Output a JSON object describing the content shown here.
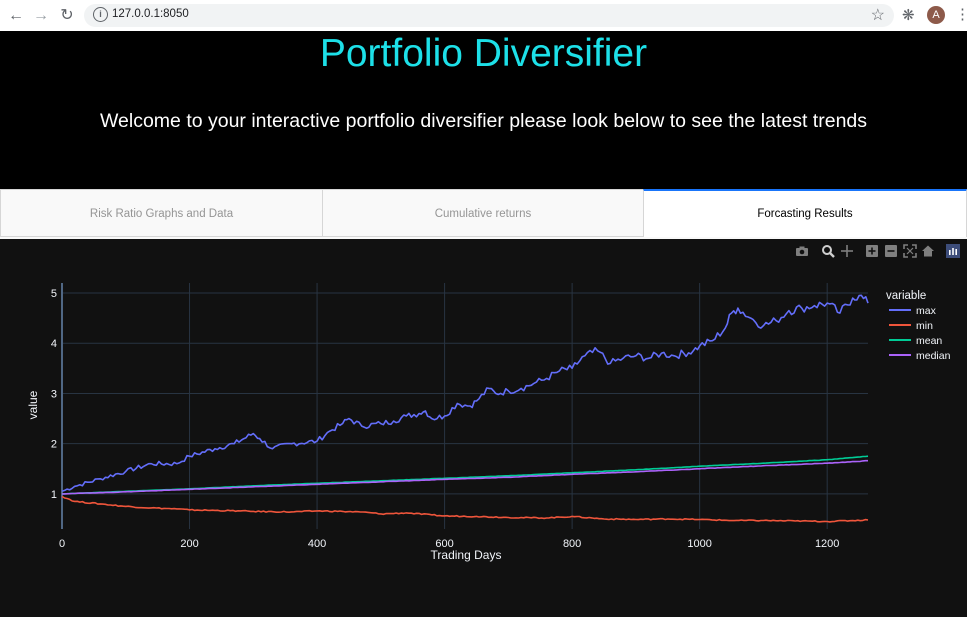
{
  "browser": {
    "url": "127.0.0.1:8050",
    "avatar_letter": "A"
  },
  "header": {
    "title": "Portfolio Diversifier",
    "subtitle": "Welcome to your interactive portfolio diversifier please look below to see the latest trends",
    "title_color": "#1de0e8"
  },
  "tabs": [
    {
      "label": "Risk Ratio Graphs and Data",
      "active": false
    },
    {
      "label": "Cumulative returns",
      "active": false
    },
    {
      "label": "Forcasting Results",
      "active": true
    }
  ],
  "modebar": [
    "camera-icon",
    "zoom-icon",
    "pan-icon",
    "zoom-in-icon",
    "zoom-out-icon",
    "autoscale-icon",
    "reset-axes-icon",
    "plotly-logo-icon"
  ],
  "chart_data": {
    "type": "line",
    "xlabel": "Trading Days",
    "ylabel": "value",
    "xlim": [
      0,
      1264
    ],
    "ylim": [
      0.3,
      5.2
    ],
    "xticks": [
      "0",
      "200",
      "400",
      "600",
      "800",
      "1000",
      "1200"
    ],
    "yticks": [
      "1",
      "2",
      "3",
      "4",
      "5"
    ],
    "legend_title": "variable",
    "legend_position": "right",
    "grid": true,
    "series": [
      {
        "name": "max",
        "color": "#636efa",
        "x": [
          0,
          20,
          60,
          100,
          140,
          180,
          200,
          240,
          270,
          300,
          310,
          330,
          360,
          400,
          420,
          440,
          450,
          470,
          500,
          520,
          540,
          560,
          570,
          580,
          600,
          620,
          640,
          650,
          670,
          680,
          700,
          720,
          740,
          760,
          780,
          800,
          820,
          840,
          860,
          880,
          900,
          920,
          940,
          960,
          990,
          1000,
          1020,
          1040,
          1050,
          1060,
          1080,
          1100,
          1120,
          1140,
          1160,
          1180,
          1200,
          1220,
          1240,
          1250,
          1264
        ],
        "y": [
          1.05,
          1.15,
          1.3,
          1.45,
          1.6,
          1.6,
          1.75,
          1.9,
          2.0,
          2.2,
          2.1,
          1.9,
          2.0,
          2.05,
          2.25,
          2.4,
          2.5,
          2.35,
          2.4,
          2.45,
          2.55,
          2.6,
          2.65,
          2.5,
          2.55,
          2.8,
          2.75,
          2.85,
          3.1,
          3.0,
          3.05,
          3.1,
          3.2,
          3.3,
          3.45,
          3.5,
          3.75,
          3.85,
          3.6,
          3.7,
          3.75,
          3.7,
          3.8,
          3.75,
          3.85,
          3.95,
          4.05,
          4.3,
          4.6,
          4.7,
          4.5,
          4.35,
          4.45,
          4.65,
          4.7,
          4.75,
          4.8,
          4.6,
          4.9,
          4.95,
          4.8
        ]
      },
      {
        "name": "min",
        "color": "#ef553b",
        "x": [
          0,
          20,
          60,
          100,
          140,
          180,
          200,
          240,
          280,
          300,
          360,
          400,
          440,
          480,
          500,
          540,
          580,
          600,
          650,
          700,
          760,
          800,
          850,
          900,
          950,
          1000,
          1050,
          1100,
          1150,
          1200,
          1264
        ],
        "y": [
          0.95,
          0.85,
          0.8,
          0.75,
          0.72,
          0.7,
          0.68,
          0.67,
          0.66,
          0.65,
          0.64,
          0.66,
          0.65,
          0.63,
          0.6,
          0.62,
          0.58,
          0.56,
          0.55,
          0.53,
          0.52,
          0.55,
          0.5,
          0.49,
          0.5,
          0.49,
          0.47,
          0.47,
          0.46,
          0.45,
          0.48
        ]
      },
      {
        "name": "mean",
        "color": "#00cc96",
        "x": [
          0,
          100,
          200,
          300,
          400,
          500,
          600,
          700,
          800,
          900,
          1000,
          1100,
          1200,
          1264
        ],
        "y": [
          1.0,
          1.05,
          1.1,
          1.16,
          1.21,
          1.26,
          1.31,
          1.36,
          1.42,
          1.48,
          1.55,
          1.61,
          1.68,
          1.75
        ]
      },
      {
        "name": "median",
        "color": "#ab63fa",
        "x": [
          0,
          100,
          200,
          300,
          400,
          500,
          600,
          700,
          800,
          900,
          1000,
          1100,
          1200,
          1264
        ],
        "y": [
          1.0,
          1.04,
          1.09,
          1.14,
          1.19,
          1.24,
          1.29,
          1.33,
          1.39,
          1.44,
          1.5,
          1.56,
          1.61,
          1.66
        ]
      }
    ]
  }
}
